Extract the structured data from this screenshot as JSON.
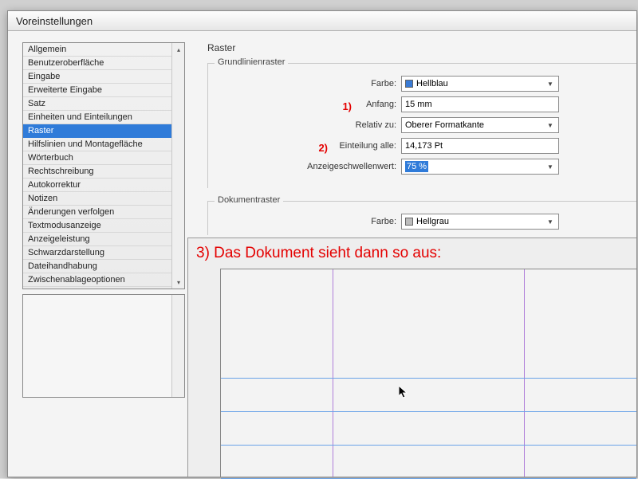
{
  "window": {
    "title": "Voreinstellungen"
  },
  "sidebar": {
    "items": [
      {
        "label": "Allgemein"
      },
      {
        "label": "Benutzeroberfläche"
      },
      {
        "label": "Eingabe"
      },
      {
        "label": "Erweiterte Eingabe"
      },
      {
        "label": "Satz"
      },
      {
        "label": "Einheiten und Einteilungen"
      },
      {
        "label": "Raster",
        "selected": true
      },
      {
        "label": "Hilfslinien und Montagefläche"
      },
      {
        "label": "Wörterbuch"
      },
      {
        "label": "Rechtschreibung"
      },
      {
        "label": "Autokorrektur"
      },
      {
        "label": "Notizen"
      },
      {
        "label": "Änderungen verfolgen"
      },
      {
        "label": "Textmodusanzeige"
      },
      {
        "label": "Anzeigeleistung"
      },
      {
        "label": "Schwarzdarstellung"
      },
      {
        "label": "Dateihandhabung"
      },
      {
        "label": "Zwischenablageoptionen"
      }
    ]
  },
  "main": {
    "title": "Raster",
    "group1": {
      "legend": "Grundlinienraster",
      "color_label": "Farbe:",
      "color_value": "Hellblau",
      "color_swatch": "#3a7bd5",
      "start_label": "Anfang:",
      "start_value": "15 mm",
      "start_annot": "1)",
      "relative_label": "Relativ zu:",
      "relative_value": "Oberer Formatkante",
      "increment_label": "Einteilung alle:",
      "increment_value": "14,173 Pt",
      "increment_annot": "2)",
      "threshold_label": "Anzeigeschwellenwert:",
      "threshold_value": "75 %"
    },
    "group2": {
      "legend": "Dokumentraster",
      "color_label": "Farbe:",
      "color_value": "Hellgrau",
      "color_swatch": "#bdbdbd"
    },
    "preview_caption": "3) Das Dokument sieht dann so aus:"
  }
}
